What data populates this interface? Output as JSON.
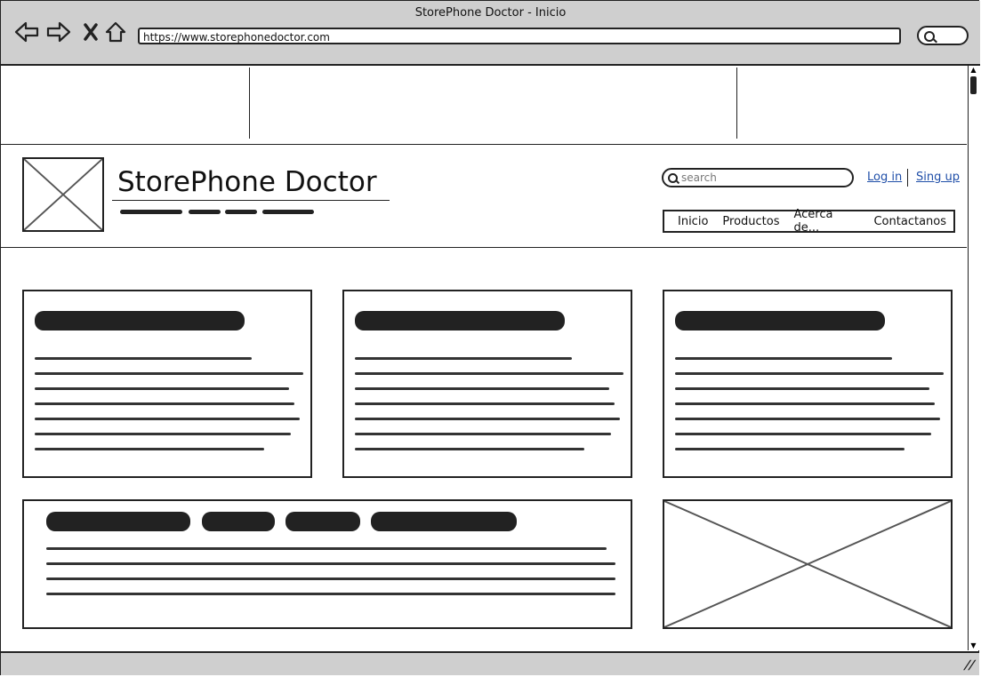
{
  "browser": {
    "window_title": "StorePhone Doctor - Inicio",
    "url": "https://www.storephonedoctor.com",
    "back_icon": "back-arrow-icon",
    "forward_icon": "forward-arrow-icon",
    "stop_icon": "close-icon",
    "home_icon": "home-icon",
    "search_icon": "search-icon"
  },
  "header": {
    "site_title": "StorePhone Doctor",
    "search_placeholder": "search",
    "login_label": "Log in",
    "signup_label": "Sing up",
    "menu": [
      "Inicio",
      "Productos",
      "Acerca de...",
      "Contactanos"
    ]
  }
}
